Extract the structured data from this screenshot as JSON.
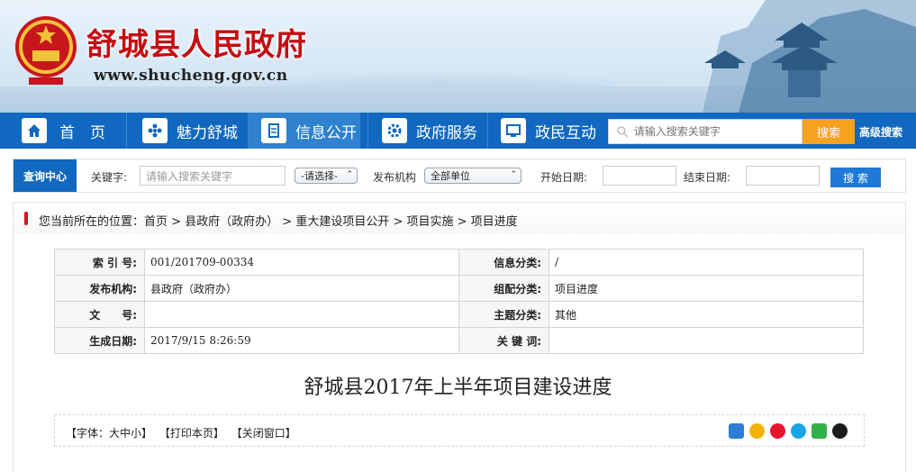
{
  "header": {
    "title": "舒城县人民政府",
    "url": "www.shucheng.gov.cn"
  },
  "nav": {
    "items": [
      {
        "label": "首　页",
        "icon": "home-icon"
      },
      {
        "label": "魅力舒城",
        "icon": "flower-icon"
      },
      {
        "label": "信息公开",
        "icon": "document-icon"
      },
      {
        "label": "政府服务",
        "icon": "gear-icon"
      },
      {
        "label": "政民互动",
        "icon": "monitor-icon"
      }
    ],
    "search_placeholder": "请输入搜索关键字",
    "search_button": "搜索",
    "advanced_search": "高级搜索"
  },
  "query": {
    "label": "查询中心",
    "keyword_label": "关键字:",
    "keyword_placeholder": "请输入搜索关键字",
    "select_default": "-请选择-",
    "publisher_label": "发布机构",
    "publisher_value": "全部单位",
    "start_label": "开始日期:",
    "end_label": "结束日期:",
    "button": "搜 索"
  },
  "breadcrumb": {
    "text": "您当前所在的位置：首页 > 县政府（政府办） > 重大建设项目公开 > 项目实施 > 项目进度"
  },
  "info": {
    "index_label": "索 引 号:",
    "index_value": "001/201709-00334",
    "category_label": "信息分类:",
    "category_value": "/",
    "publisher_label": "发布机构:",
    "publisher_value": "县政府（政府办）",
    "group_label": "组配分类:",
    "group_value": "项目进度",
    "docno_label": "文　　号:",
    "docno_value": "",
    "topic_label": "主题分类:",
    "topic_value": "其他",
    "date_label": "生成日期:",
    "date_value": "2017/9/15 8:26:59",
    "keyword_label": "关 键 词:",
    "keyword_value": ""
  },
  "document": {
    "title": "舒城县2017年上半年项目建设进度"
  },
  "tools": {
    "font": "【字体：大中小】",
    "print": "【打印本页】",
    "close": "【关闭窗口】"
  },
  "colors": {
    "nav": "#1068c0",
    "nav_active": "#2e82d0",
    "title_red": "#c40d12",
    "search_orange": "#f6a21e"
  }
}
